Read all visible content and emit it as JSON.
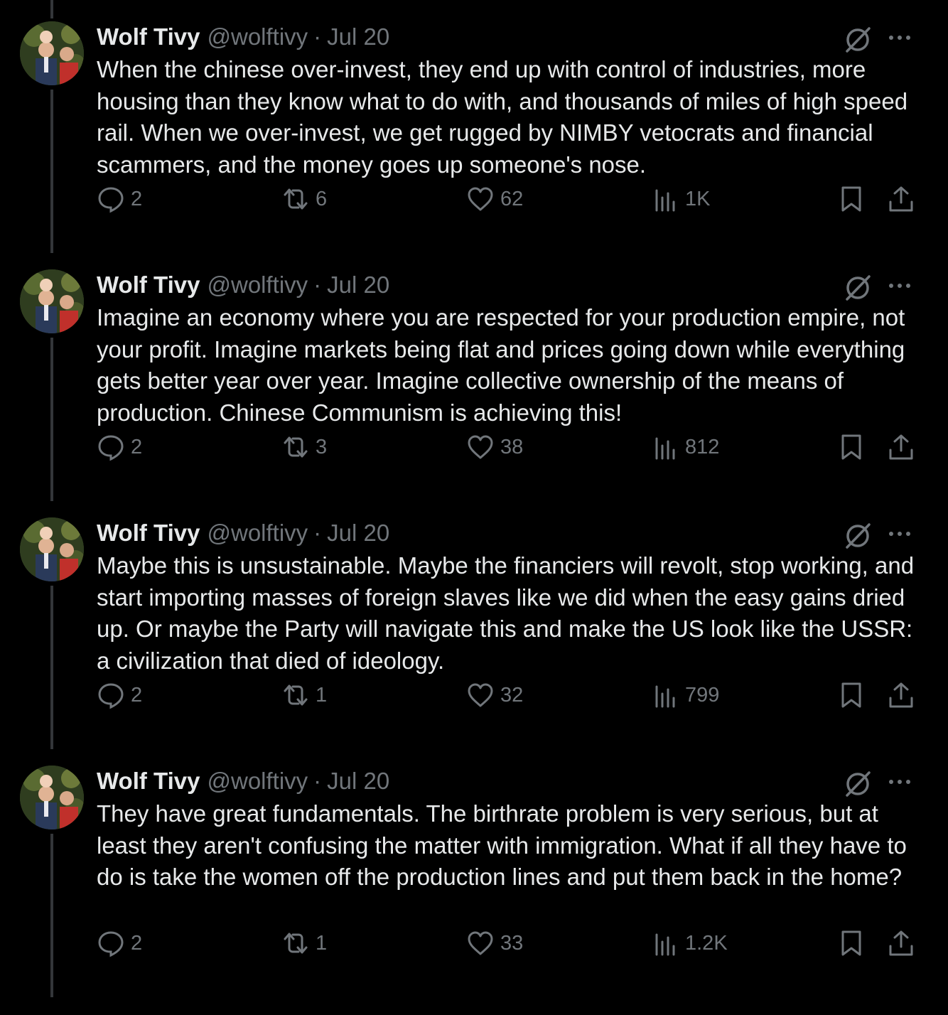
{
  "colors": {
    "background": "#000000",
    "text": "#e7e9ea",
    "muted": "#71767b",
    "thread_line": "#333639"
  },
  "tweets": [
    {
      "author": {
        "name": "Wolf Tivy",
        "handle": "@wolftivy"
      },
      "separator": "·",
      "date": "Jul 20",
      "text": "When the chinese over-invest, they end up with control of industries, more housing than they know what to do with, and thousands of miles of high speed rail. When we over-invest, we get rugged by NIMBY vetocrats and financial scammers, and the money goes up someone's nose.",
      "stats": {
        "replies": "2",
        "reposts": "6",
        "likes": "62",
        "views": "1K"
      }
    },
    {
      "author": {
        "name": "Wolf Tivy",
        "handle": "@wolftivy"
      },
      "separator": "·",
      "date": "Jul 20",
      "text": "Imagine an economy where you are respected for your production empire, not your profit. Imagine markets being flat and prices going down while everything gets better year over year. Imagine collective ownership of the means of production. Chinese Communism is achieving this!",
      "stats": {
        "replies": "2",
        "reposts": "3",
        "likes": "38",
        "views": "812"
      }
    },
    {
      "author": {
        "name": "Wolf Tivy",
        "handle": "@wolftivy"
      },
      "separator": "·",
      "date": "Jul 20",
      "text": "Maybe this is unsustainable. Maybe the financiers will revolt, stop working, and start importing masses of foreign slaves like we did when the easy gains dried up. Or maybe the Party will navigate this and make the US look like the USSR: a civilization that died of ideology.",
      "stats": {
        "replies": "2",
        "reposts": "1",
        "likes": "32",
        "views": "799"
      }
    },
    {
      "author": {
        "name": "Wolf Tivy",
        "handle": "@wolftivy"
      },
      "separator": "·",
      "date": "Jul 20",
      "text": "They have great fundamentals. The birthrate problem is very serious, but at least they aren't confusing the matter with immigration. What if all they have to do is take the women off the production lines and put them back in the home?",
      "stats": {
        "replies": "2",
        "reposts": "1",
        "likes": "33",
        "views": "1.2K"
      }
    }
  ],
  "icons": [
    "avatar",
    "grok-icon",
    "more-icon",
    "reply-icon",
    "repost-icon",
    "like-icon",
    "views-icon",
    "bookmark-icon",
    "share-icon"
  ]
}
